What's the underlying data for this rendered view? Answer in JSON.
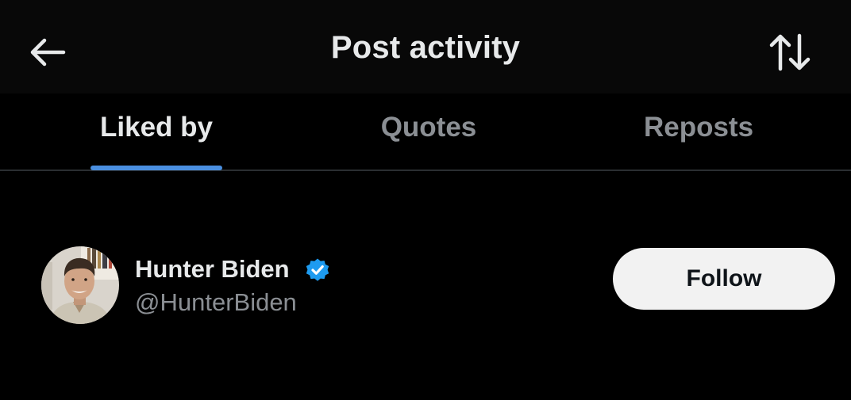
{
  "header": {
    "title": "Post activity",
    "back_icon": "arrow-left-icon",
    "sort_icon": "sort-arrows-icon"
  },
  "tabs": [
    {
      "label": "Liked by",
      "active": true
    },
    {
      "label": "Quotes",
      "active": false
    },
    {
      "label": "Reposts",
      "active": false
    }
  ],
  "users": [
    {
      "display_name": "Hunter Biden",
      "handle": "@HunterBiden",
      "verified": true,
      "follow_label": "Follow"
    }
  ],
  "colors": {
    "background": "#000000",
    "header_background": "#080808",
    "accent": "#4a8fe0",
    "verified": "#1d9bf0",
    "text_primary": "#e7e9ea",
    "text_secondary": "#8b8f94",
    "follow_button": "#f2f2f2"
  }
}
